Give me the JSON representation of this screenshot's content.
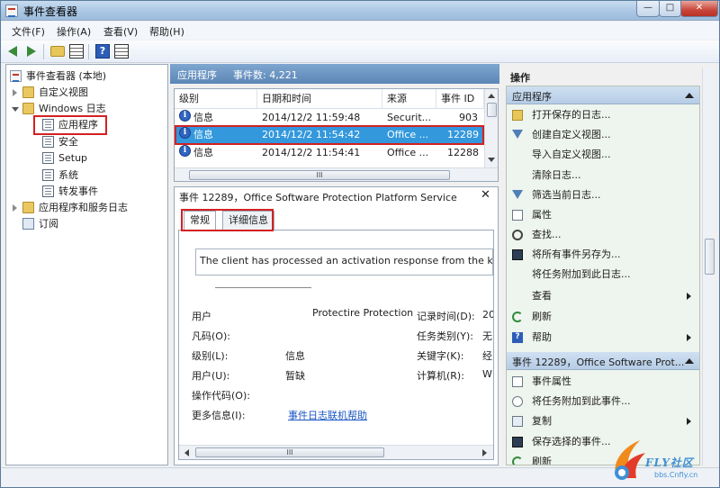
{
  "window": {
    "title": "事件查看器"
  },
  "window_controls": {
    "minimize": "—",
    "maximize": "□",
    "close": "✕"
  },
  "menu": {
    "items": [
      "文件(F)",
      "操作(A)",
      "查看(V)",
      "帮助(H)"
    ]
  },
  "tree": {
    "root": "事件查看器 (本地)",
    "custom_views": "自定义视图",
    "windows_logs": "Windows 日志",
    "logs": [
      "应用程序",
      "安全",
      "Setup",
      "系统",
      "转发事件"
    ],
    "app_service_logs": "应用程序和服务日志",
    "subscriptions": "订阅"
  },
  "middle": {
    "title": "应用程序",
    "event_count": "事件数: 4,221",
    "columns": [
      "级别",
      "日期和时间",
      "来源",
      "事件 ID"
    ],
    "rows": [
      {
        "level": "信息",
        "datetime": "2014/12/2 11:59:48",
        "source": "Securit...",
        "id": "903"
      },
      {
        "level": "信息",
        "datetime": "2014/12/2 11:54:42",
        "source": "Office ...",
        "id": "12289"
      },
      {
        "level": "信息",
        "datetime": "2014/12/2 11:54:41",
        "source": "Office ...",
        "id": "12288"
      }
    ],
    "scroll_grip": "III"
  },
  "detail": {
    "title": "事件 12289，Office Software Protection Platform Service",
    "close": "✕",
    "tabs": [
      "常规",
      "详细信息"
    ],
    "description": "The client has processed an activation response from the key",
    "fields_left": [
      {
        "label": "用户",
        "value": "Protectire Protection"
      },
      {
        "label": "凡码(O):",
        "value": ""
      },
      {
        "label": "级别(L):",
        "value": "信息"
      },
      {
        "label": "用户(U):",
        "value": "暂缺"
      },
      {
        "label": "操作代码(O):",
        "value": ""
      },
      {
        "label": "更多信息(I):",
        "value": "事件日志联机帮助"
      }
    ],
    "fields_right": [
      {
        "label": "记录时间(D):",
        "value": "20"
      },
      {
        "label": "任务类别(Y):",
        "value": "无"
      },
      {
        "label": "关键字(K):",
        "value": "经"
      },
      {
        "label": "计算机(R):",
        "value": "W"
      }
    ],
    "scroll_grip": "III"
  },
  "actions": {
    "header": "操作",
    "section1": "应用程序",
    "items1": [
      "打开保存的日志...",
      "创建自定义视图...",
      "导入自定义视图...",
      "清除日志...",
      "筛选当前日志...",
      "属性",
      "查找...",
      "将所有事件另存为...",
      "将任务附加到此日志...",
      "查看",
      "刷新",
      "帮助"
    ],
    "section2": "事件 12289，Office Software Prot...",
    "items2": [
      "事件属性",
      "将任务附加到此事件...",
      "复制",
      "保存选择的事件...",
      "刷新"
    ]
  },
  "watermark": {
    "brand": "FLY社区",
    "url": "bbs.Cnfly.cn"
  }
}
